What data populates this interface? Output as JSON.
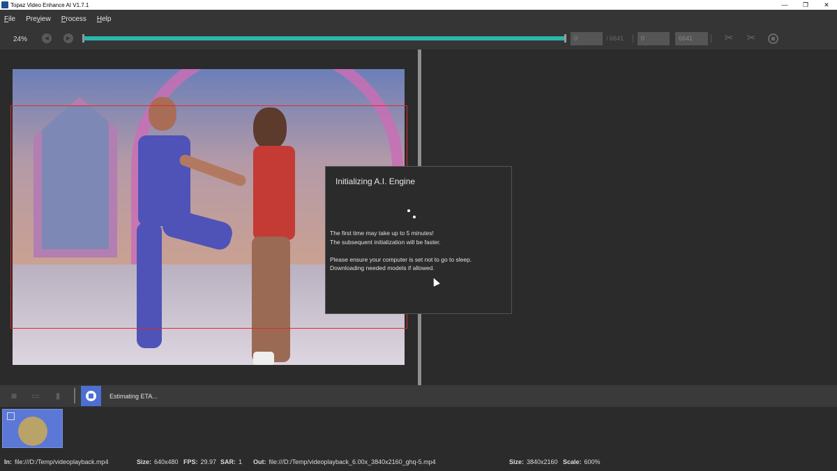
{
  "window": {
    "title": "Topaz Video Enhance AI V1.7.1",
    "controls": [
      "—",
      "❐",
      "✕"
    ]
  },
  "menu": [
    {
      "label": "File",
      "key": "F",
      "rest": "ile"
    },
    {
      "label": "Preview",
      "key": "Pre",
      "ukey": "v",
      "rest": "iew"
    },
    {
      "label": "Process",
      "key": "P",
      "rest": "rocess"
    },
    {
      "label": "Help",
      "key": "H",
      "rest": "elp"
    }
  ],
  "toolbar": {
    "zoom": "24%",
    "frame_current": "0",
    "frame_total": "/ 6641",
    "range_start": "0",
    "range_end": "6641",
    "progress_fraction": 1.0
  },
  "dialog": {
    "title": "Initializing A.I. Engine",
    "line1": "The first time may take up to 5 minutes!",
    "line2": "The subsequent initialization will be faster.",
    "line3": "Please ensure your computer is set not to go to sleep.",
    "line4": "Downloading needed models if allowed."
  },
  "actionbar": {
    "status": "Estimating ETA..."
  },
  "statusbar": {
    "in_label": "In:",
    "in_value": "file:///D:/Temp/videoplayback.mp4",
    "size_label": "Size:",
    "size_value": "640x480",
    "fps_label": "FPS:",
    "fps_value": "29.97",
    "sar_label": "SAR:",
    "sar_value": "1",
    "out_label": "Out:",
    "out_value": "file:///D:/Temp/videoplayback_6.00x_3840x2160_ghq-5.mp4",
    "out_size_label": "Size:",
    "out_size_value": "3840x2160",
    "scale_label": "Scale:",
    "scale_value": "600%"
  },
  "colors": {
    "accent": "#2bb6ad",
    "stop_button": "#4d6fd1",
    "crop_rect": "#e02a2a"
  },
  "icons": [
    "app-logo-icon",
    "prev-frame-icon",
    "next-frame-icon",
    "scissors-icon",
    "cut-range-icon",
    "stop-icon",
    "camera-icon",
    "video-camera-icon",
    "trash-icon",
    "checkbox-icon"
  ]
}
